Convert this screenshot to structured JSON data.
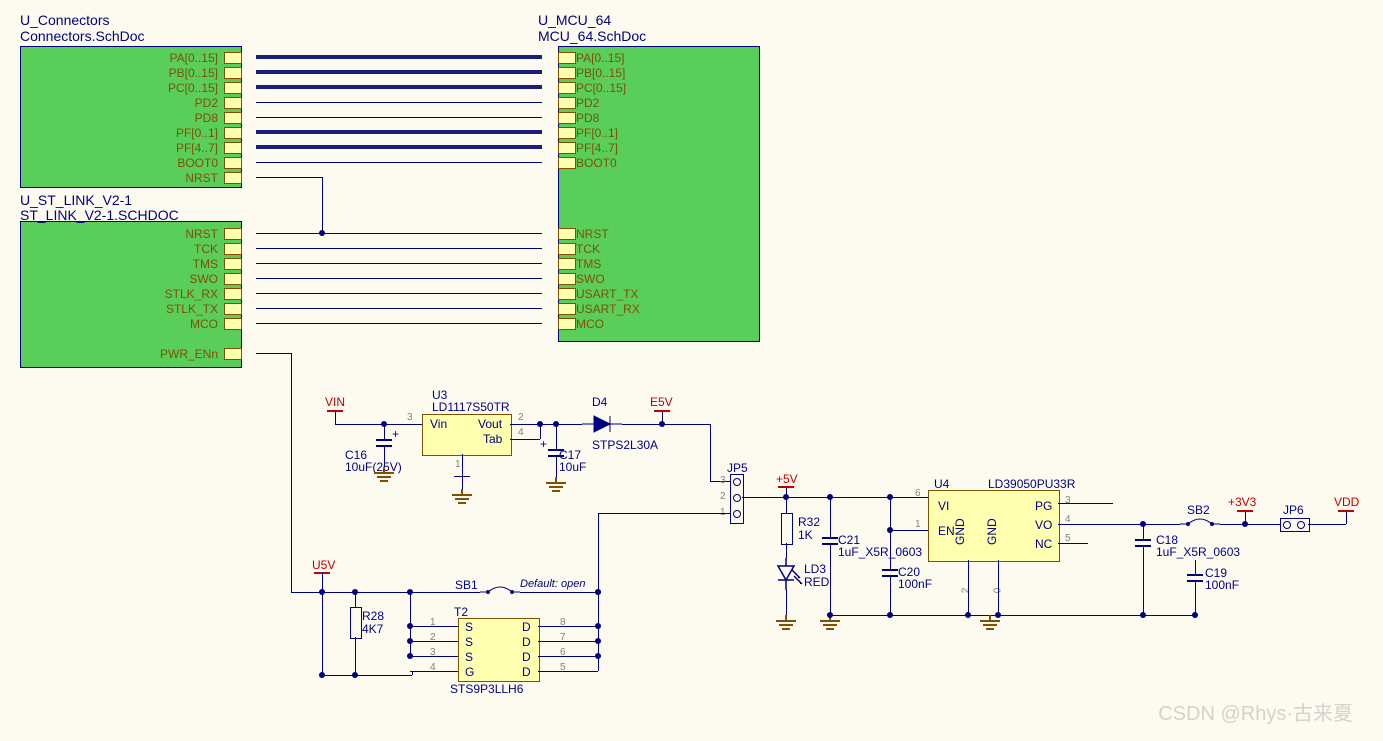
{
  "blocks": {
    "connectors": {
      "title": "U_Connectors",
      "doc": "Connectors.SchDoc",
      "pins": [
        "PA[0..15]",
        "PB[0..15]",
        "PC[0..15]",
        "PD2",
        "PD8",
        "PF[0..1]",
        "PF[4..7]",
        "BOOT0",
        "NRST"
      ]
    },
    "mcu": {
      "title": "U_MCU_64",
      "doc": "MCU_64.SchDoc",
      "pinsL": [
        "PA[0..15]",
        "PB[0..15]",
        "PC[0..15]",
        "PD2",
        "PD8",
        "PF[0..1]",
        "PF[4..7]",
        "BOOT0"
      ],
      "pinsL2": [
        "NRST",
        "TCK",
        "TMS",
        "SWO",
        "USART_TX",
        "USART_RX",
        "MCO"
      ]
    },
    "stlink": {
      "title": "U_ST_LINK_V2-1",
      "doc": "ST_LINK_V2-1.SCHDOC",
      "pins": [
        "NRST",
        "TCK",
        "TMS",
        "SWO",
        "STLK_RX",
        "STLK_TX",
        "MCO"
      ],
      "pin2": "PWR_ENn"
    }
  },
  "parts": {
    "u3": {
      "ref": "U3",
      "val": "LD1117S50TR",
      "p1": "Vin",
      "p2": "Vout",
      "p3": "Tab"
    },
    "u4": {
      "ref": "U4",
      "val": "LD39050PU33R",
      "vi": "VI",
      "en": "EN",
      "pg": "PG",
      "vo": "VO",
      "nc": "NC",
      "g1": "GND",
      "g2": "GND"
    },
    "t2": {
      "ref": "T2",
      "val": "STS9P3LLH6",
      "s": "S",
      "g": "G",
      "d": "D"
    },
    "d4": {
      "ref": "D4",
      "val": "STPS2L30A"
    },
    "c16": {
      "ref": "C16",
      "val": "10uF(25V)"
    },
    "c17": {
      "ref": "C17",
      "val": "10uF"
    },
    "c21": {
      "ref": "C21",
      "val": "1uF_X5R_0603"
    },
    "c20": {
      "ref": "C20",
      "val": "100nF"
    },
    "c18": {
      "ref": "C18",
      "val": "1uF_X5R_0603"
    },
    "c19": {
      "ref": "C19",
      "val": "100nF"
    },
    "r28": {
      "ref": "R28",
      "val": "4K7"
    },
    "r32": {
      "ref": "R32",
      "val": "1K"
    },
    "ld3": {
      "ref": "LD3",
      "val": "RED"
    },
    "sb1": {
      "ref": "SB1",
      "note": "Default: open"
    },
    "sb2": "SB2",
    "jp5": "JP5",
    "jp6": "JP6"
  },
  "pwr": {
    "vin": "VIN",
    "e5v": "E5V",
    "u5v": "U5V",
    "p5v": "+5V",
    "p3v3": "+3V3",
    "vdd": "VDD"
  },
  "watermark": "CSDN @Rhys·古来夏",
  "pn": {
    "1": "1",
    "2": "2",
    "3": "3",
    "4": "4",
    "5": "5",
    "6": "6",
    "7": "7",
    "8": "8"
  }
}
